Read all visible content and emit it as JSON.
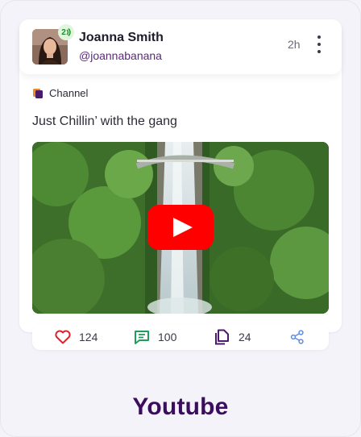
{
  "post": {
    "author_name": "Joanna Smith",
    "handle": "@joannabanana",
    "badge_text": "2",
    "time": "2h",
    "channel_label": "Channel",
    "text": "Just Chillin’ with the gang"
  },
  "actions": {
    "likes": "124",
    "comments": "100",
    "shares": "24"
  },
  "footer": {
    "title": "Youtube"
  },
  "colors": {
    "accent_purple": "#3b0d5e",
    "like_red": "#e0202a",
    "comment_green": "#1f9e5a",
    "copy_purple": "#4a1a6e",
    "share_blue": "#5b8de6",
    "play_red": "#ff0000"
  },
  "icons": {
    "more": "more-vertical-icon",
    "heart": "heart-icon",
    "comment": "comment-icon",
    "copy": "copy-icon",
    "share": "share-icon",
    "play": "youtube-play-icon",
    "channel": "channel-icon"
  }
}
